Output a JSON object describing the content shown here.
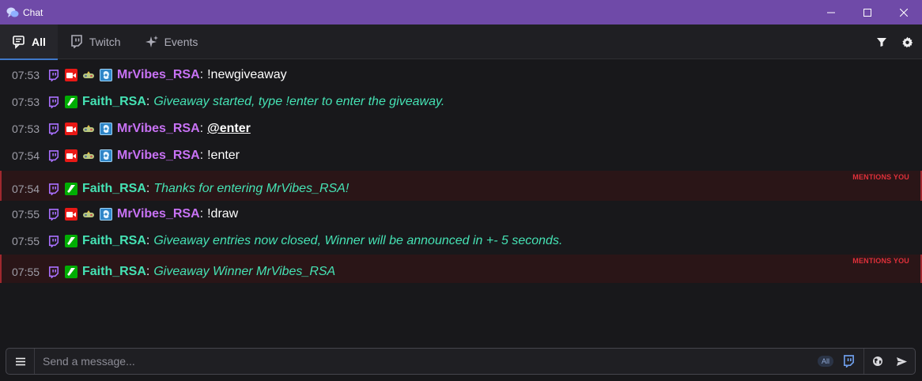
{
  "window": {
    "title": "Chat",
    "icon": "chat-bubbles-icon"
  },
  "tabs": [
    {
      "label": "All",
      "icon": "chat-list-icon",
      "active": true
    },
    {
      "label": "Twitch",
      "icon": "twitch-icon",
      "active": false
    },
    {
      "label": "Events",
      "icon": "sparkles-icon",
      "active": false
    }
  ],
  "toolbar": {
    "filter_icon": "filter-icon",
    "settings_icon": "gear-icon"
  },
  "colors": {
    "titlebar": "#6f4aa8",
    "mrvibes": "#c872f5",
    "faith": "#45e2b4",
    "mention_tag": "#e0303a",
    "twitch": "#a970ff"
  },
  "mention_label": "MENTIONS YOU",
  "messages": [
    {
      "time": "07:53",
      "user": "MrVibes_RSA",
      "text": "!newgiveaway"
    },
    {
      "time": "07:53",
      "user": "Faith_RSA",
      "text": "Giveaway started, type !enter to enter the giveaway."
    },
    {
      "time": "07:53",
      "user": "MrVibes_RSA",
      "text": "@enter"
    },
    {
      "time": "07:54",
      "user": "MrVibes_RSA",
      "text": "!enter"
    },
    {
      "time": "07:54",
      "user": "Faith_RSA",
      "text": "Thanks for entering MrVibes_RSA!"
    },
    {
      "time": "07:55",
      "user": "MrVibes_RSA",
      "text": "!draw"
    },
    {
      "time": "07:55",
      "user": "Faith_RSA",
      "text": "Giveaway entries now closed, Winner will be announced in +- 5 seconds."
    },
    {
      "time": "07:55",
      "user": "Faith_RSA",
      "text": "Giveaway Winner MrVibes_RSA"
    }
  ],
  "input": {
    "placeholder": "Send a message...",
    "target_pill": "All"
  }
}
